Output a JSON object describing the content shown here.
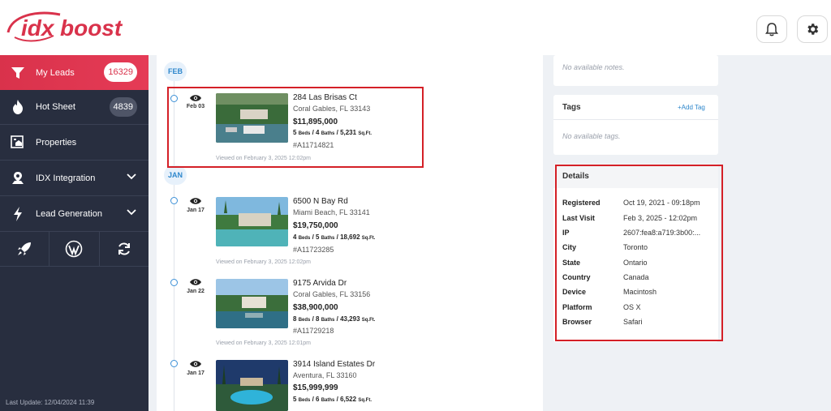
{
  "header": {
    "logo_text": "idxboost"
  },
  "sidebar": {
    "items": [
      {
        "label": "My Leads",
        "badge": "16329"
      },
      {
        "label": "Hot Sheet",
        "badge": "4839"
      },
      {
        "label": "Properties"
      },
      {
        "label": "IDX Integration"
      },
      {
        "label": "Lead Generation"
      }
    ],
    "last_update": "Last Update: 12/04/2024 11:39"
  },
  "timeline": {
    "months": [
      "FEB",
      "JAN"
    ],
    "entries": [
      {
        "date": "Feb 03",
        "address": "284 Las Brisas Ct",
        "city": "Coral Gables, FL 33143",
        "price": "$11,895,000",
        "beds": "5",
        "beds_label": "Beds",
        "baths": "4",
        "baths_label": "Baths",
        "sqft": "5,231",
        "sqft_label": "Sq.Ft.",
        "mls": "#A11714821",
        "viewed": "Viewed on February 3, 2025 12:02pm"
      },
      {
        "date": "Jan 17",
        "address": "6500 N Bay Rd",
        "city": "Miami Beach, FL 33141",
        "price": "$19,750,000",
        "beds": "4",
        "beds_label": "Beds",
        "baths": "5",
        "baths_label": "Baths",
        "sqft": "18,692",
        "sqft_label": "Sq.Ft.",
        "mls": "#A11723285",
        "viewed": "Viewed on February 3, 2025 12:02pm"
      },
      {
        "date": "Jan 22",
        "address": "9175 Arvida Dr",
        "city": "Coral Gables, FL 33156",
        "price": "$38,900,000",
        "beds": "8",
        "beds_label": "Beds",
        "baths": "8",
        "baths_label": "Baths",
        "sqft": "43,293",
        "sqft_label": "Sq.Ft.",
        "mls": "#A11729218",
        "viewed": "Viewed on February 3, 2025 12:01pm"
      },
      {
        "date": "Jan 17",
        "address": "3914 Island Estates Dr",
        "city": "Aventura, FL 33160",
        "price": "$15,999,999",
        "beds": "5",
        "beds_label": "Beds",
        "baths": "6",
        "baths_label": "Baths",
        "sqft": "6,522",
        "sqft_label": "Sq.Ft."
      }
    ]
  },
  "notes": {
    "empty_text": "No available notes."
  },
  "tags": {
    "title": "Tags",
    "add_label": "+Add Tag",
    "empty_text": "No available tags."
  },
  "details": {
    "title": "Details",
    "rows": [
      {
        "label": "Registered",
        "value": "Oct 19, 2021 - 09:18pm"
      },
      {
        "label": "Last Visit",
        "value": "Feb 3, 2025 - 12:02pm"
      },
      {
        "label": "IP",
        "value": "2607:fea8:a719:3b00:..."
      },
      {
        "label": "City",
        "value": "Toronto"
      },
      {
        "label": "State",
        "value": "Ontario"
      },
      {
        "label": "Country",
        "value": "Canada"
      },
      {
        "label": "Device",
        "value": "Macintosh"
      },
      {
        "label": "Platform",
        "value": "OS X"
      },
      {
        "label": "Browser",
        "value": "Safari"
      }
    ]
  },
  "colors": {
    "accent_red": "#d9324b",
    "sidebar_bg": "#282e3f",
    "link_blue": "#2e87cc",
    "highlight_red": "#d42027"
  }
}
